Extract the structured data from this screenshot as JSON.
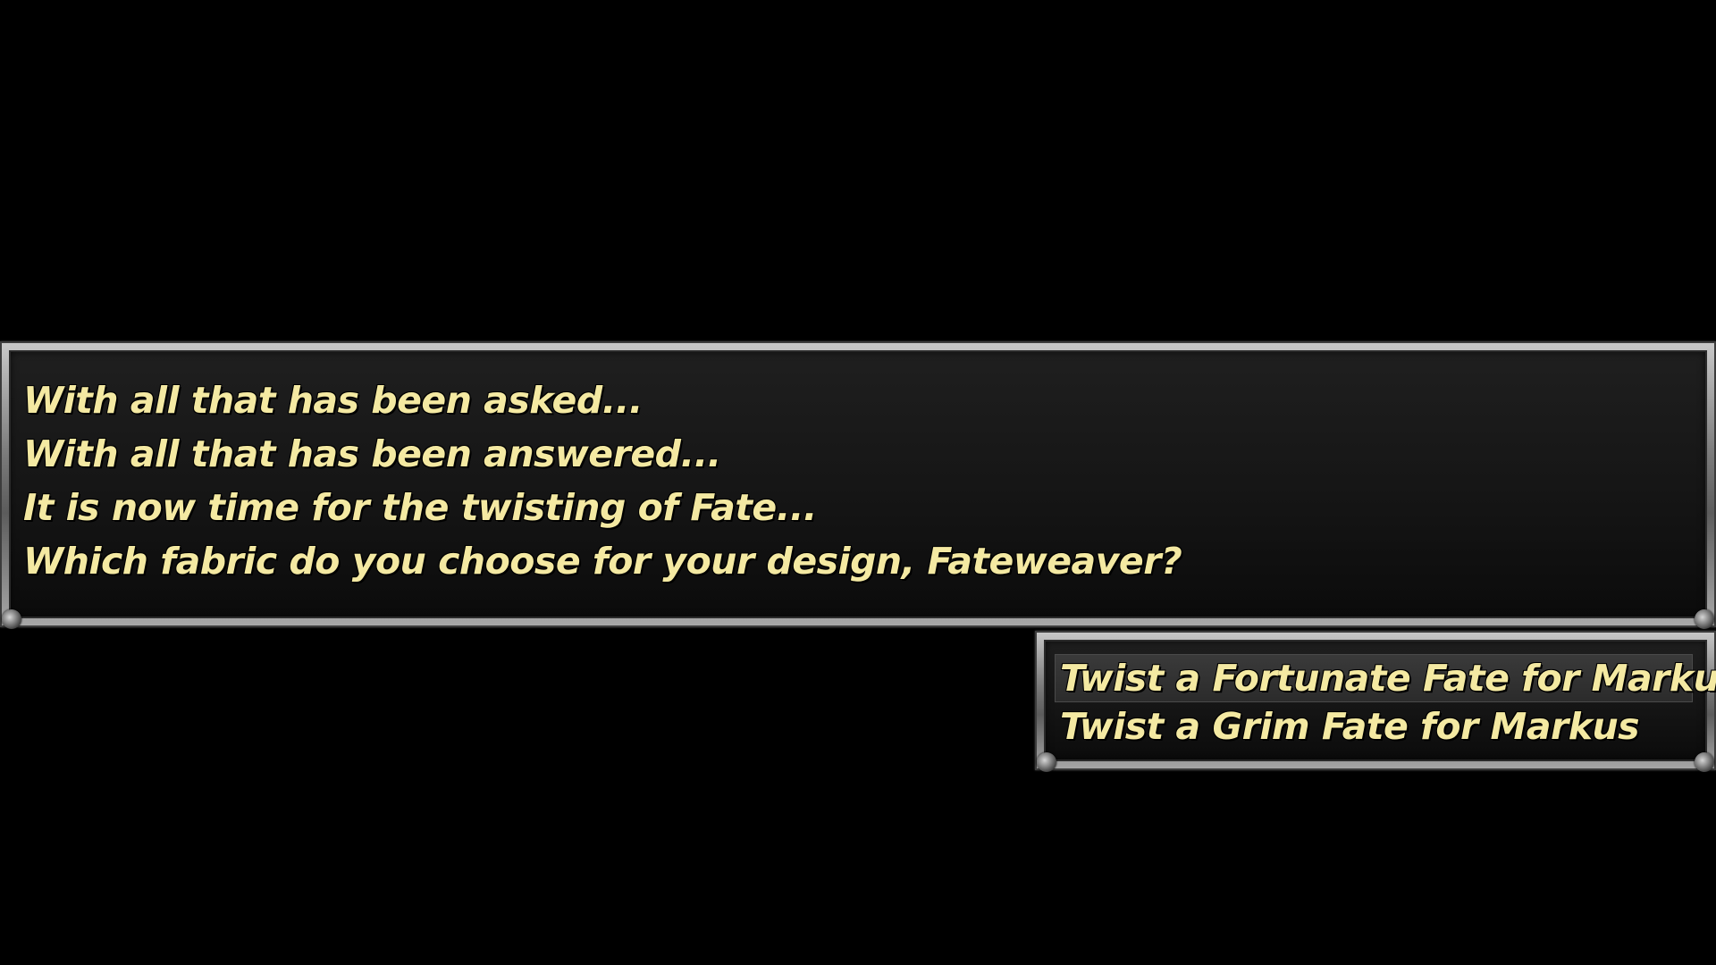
{
  "message": {
    "lines": [
      "With all that has been asked...",
      "With all that has been answered...",
      "It is now time for the twisting of Fate...",
      "Which fabric do you choose for your design, Fateweaver?"
    ]
  },
  "choices": {
    "items": [
      "Twist a Fortunate Fate for Markus",
      "Twist a Grim Fate for Markus"
    ],
    "selected_index": 0
  },
  "colors": {
    "text": "#f4e9a2",
    "background": "#000000",
    "window_fill": "#151515",
    "frame": "#8b8b8b"
  },
  "icons": {
    "frame_corner": "ornament-corner-icon"
  }
}
